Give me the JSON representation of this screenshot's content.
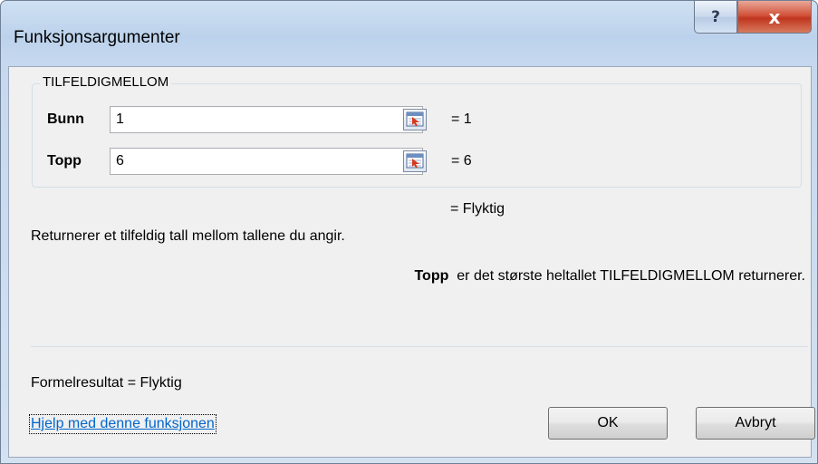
{
  "window": {
    "title": "Funksjonsargumenter"
  },
  "captions": {
    "help": "?",
    "close": "x"
  },
  "function": {
    "name": "TILFELDIGMELLOM",
    "args": [
      {
        "label": "Bunn",
        "value": "1",
        "result": "=  1"
      },
      {
        "label": "Topp",
        "value": "6",
        "result": "=  6"
      }
    ],
    "result_line": "=  Flyktig",
    "description": "Returnerer et tilfeldig tall mellom tallene du angir.",
    "arg_help_name": "Topp",
    "arg_help_text": "er det største heltallet TILFELDIGMELLOM returnerer."
  },
  "footer": {
    "formula_result": "Formelresultat =  Flyktig",
    "help_link": "Hjelp med denne funksjonen",
    "ok_label": "OK",
    "cancel_label": "Avbryt"
  },
  "icons": {
    "help": "question-icon",
    "close": "close-icon",
    "collapse": "collapse-dialog-icon"
  }
}
